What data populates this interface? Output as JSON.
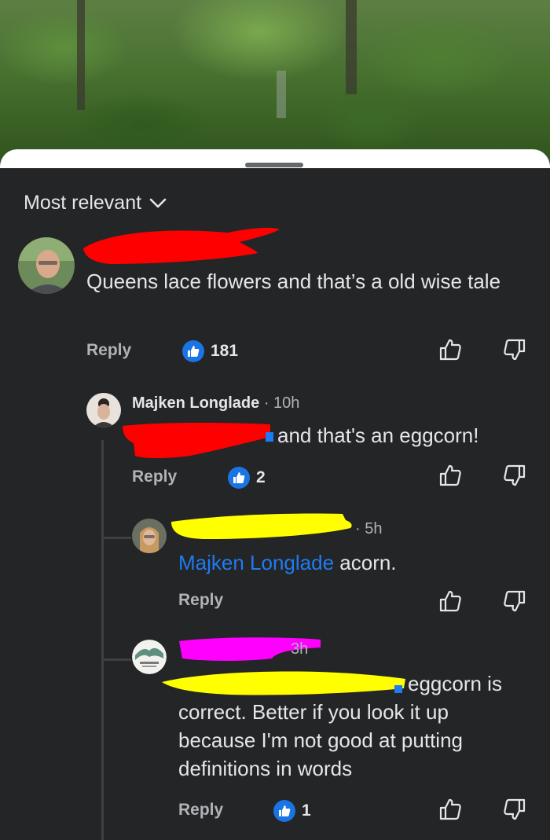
{
  "sort": {
    "label": "Most relevant"
  },
  "comments": [
    {
      "text": "Queens lace flowers and that’s a old wise tale",
      "reply_label": "Reply",
      "likes": "181"
    },
    {
      "author": "Majken Longlade",
      "time": "· 10h",
      "text": "and that's an eggcorn!",
      "reply_label": "Reply",
      "likes": "2"
    },
    {
      "time": "· 5h",
      "mention": "Majken Longlade",
      "text": " acorn.",
      "reply_label": "Reply"
    },
    {
      "time": "3h",
      "text": "eggcorn is correct. Better if you look it up because I'm not good at putting definitions in words",
      "reply_label": "Reply",
      "likes": "1"
    }
  ],
  "colors": {
    "background": "#242526",
    "text": "#e4e6eb",
    "secondary": "#b0b3b8",
    "link": "#1f7bf2",
    "like_badge": "#1b74e4",
    "redaction_red": "#ff0000",
    "redaction_yellow": "#ffff00",
    "redaction_magenta": "#ff00ff"
  },
  "icons": [
    "chevron-down-icon",
    "like-badge-icon",
    "upvote-icon",
    "downvote-icon"
  ]
}
